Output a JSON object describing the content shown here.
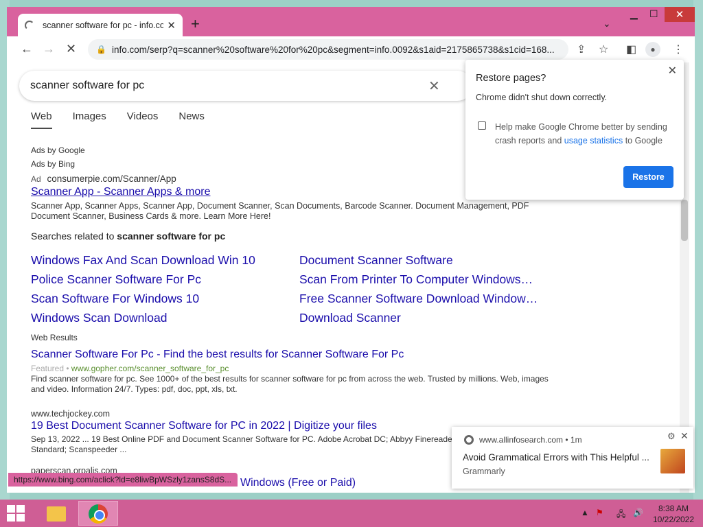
{
  "browser": {
    "tab_title": "scanner software for pc - info.com",
    "url": "info.com/serp?q=scanner%20software%20for%20pc&segment=info.0092&s1aid=2175865738&s1cid=168...",
    "status_url": "https://www.bing.com/aclick?ld=e8liwBpWSzly1zansS8dS..."
  },
  "search": {
    "query": "scanner software for pc",
    "tabs": [
      "Web",
      "Images",
      "Videos",
      "News"
    ]
  },
  "ads": {
    "by_google": "Ads by Google",
    "by_bing": "Ads by Bing",
    "tag": "Ad",
    "url": "consumerpie.com/Scanner/App",
    "title": "Scanner App - Scanner Apps & more",
    "desc": "Scanner App, Scanner Apps, Scanner App, Document Scanner, Scan Documents, Barcode Scanner. Document Management, PDF Document Scanner, Business Cards & more. Learn More Here!"
  },
  "related": {
    "heading_prefix": "Searches related to ",
    "heading_query": "scanner software for pc",
    "items": [
      "Windows Fax And Scan Download Win 10",
      "Police Scanner Software For Pc",
      "Scan Software For Windows 10",
      "Windows Scan Download",
      "Document Scanner Software",
      "Scan From Printer To Computer Windows…",
      "Free Scanner Software Download Window…",
      "Download Scanner"
    ]
  },
  "web_results_label": "Web Results",
  "results": [
    {
      "title": "Scanner Software For Pc - Find the best results for Scanner Software For Pc",
      "featured": "Featured • ",
      "url": "www.gopher.com/scanner_software_for_pc",
      "desc": "Find scanner software for pc. See 1000+ of the best results for scanner software for pc from across the web. Trusted by millions. Web, images and video. Information 24/7. Types: pdf, doc, ppt, xls, txt."
    },
    {
      "site": "www.techjockey.com",
      "title": "19 Best Document Scanner Software for PC in 2022 | Digitize your files",
      "desc": "Sep 13, 2022 ... 19 Best Online PDF and Document Scanner Software for PC. Adobe Acrobat DC; Abbyy Finereader Standard; Scanspeeder ..."
    },
    {
      "site": "paperscan.orpalis.com",
      "title": "Windows (Free or Paid)"
    }
  ],
  "popup": {
    "title": "Restore pages?",
    "subtitle": "Chrome didn't shut down correctly.",
    "checkbox_text": "Help make Google Chrome better by sending crash reports and ",
    "checkbox_link": "usage statistics",
    "checkbox_tail": " to Google",
    "restore_label": "Restore"
  },
  "notification": {
    "source": "www.allinfosearch.com",
    "age": "1m",
    "title": "Avoid Grammatical Errors with This Helpful ...",
    "from": "Grammarly"
  },
  "taskbar": {
    "time": "8:38 AM",
    "date": "10/22/2022"
  },
  "colors": {
    "frame": "#d9629e",
    "link": "#1a0dab",
    "restore_button": "#1a73e8"
  }
}
